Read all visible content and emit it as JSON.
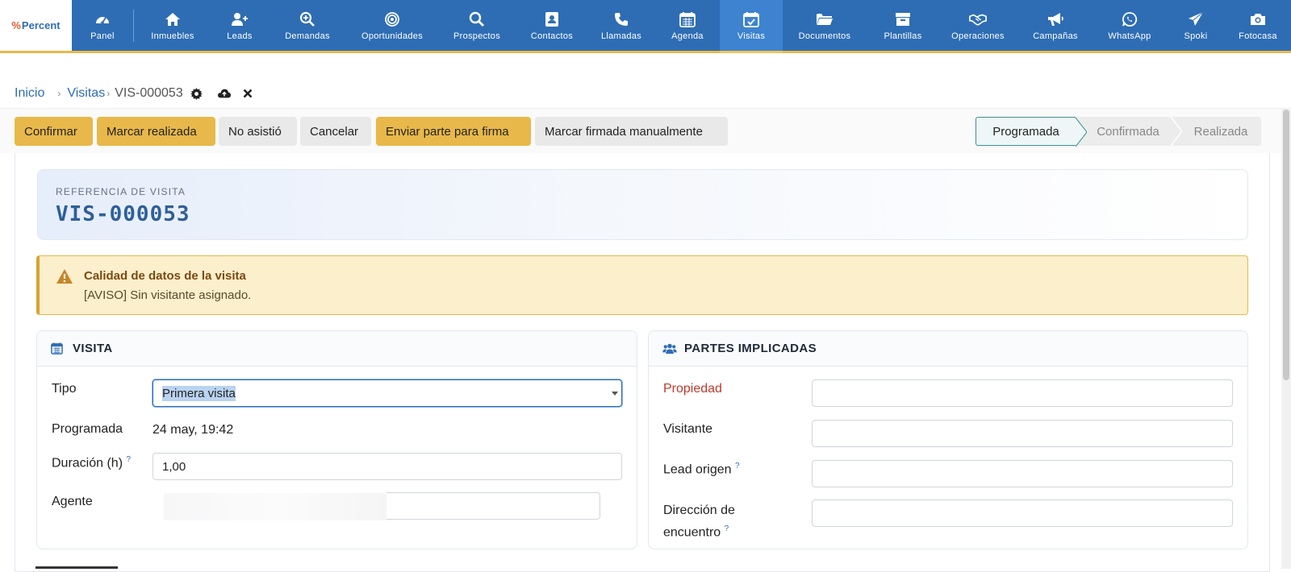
{
  "nav": {
    "logo_text": "Percent",
    "items": [
      {
        "label": "Panel",
        "icon": "dashboard-icon"
      },
      {
        "label": "Inmuebles",
        "icon": "home-icon"
      },
      {
        "label": "Leads",
        "icon": "user-plus-icon"
      },
      {
        "label": "Demandas",
        "icon": "search-plus-icon"
      },
      {
        "label": "Oportunidades",
        "icon": "target-icon"
      },
      {
        "label": "Prospectos",
        "icon": "search-icon"
      },
      {
        "label": "Contactos",
        "icon": "address-book-icon"
      },
      {
        "label": "Llamadas",
        "icon": "phone-icon"
      },
      {
        "label": "Agenda",
        "icon": "calendar-icon"
      },
      {
        "label": "Visitas",
        "icon": "calendar-check-icon",
        "active": true
      },
      {
        "label": "Documentos",
        "icon": "folder-open-icon"
      },
      {
        "label": "Plantillas",
        "icon": "archive-icon"
      },
      {
        "label": "Operaciones",
        "icon": "handshake-icon"
      },
      {
        "label": "Campañas",
        "icon": "megaphone-icon"
      },
      {
        "label": "WhatsApp",
        "icon": "whatsapp-icon"
      },
      {
        "label": "Spoki",
        "icon": "paper-plane-icon"
      },
      {
        "label": "Fotocasa",
        "icon": "camera-icon"
      }
    ]
  },
  "breadcrumb": {
    "home": "Inicio",
    "section": "Visitas",
    "current": "VIS-000053"
  },
  "actions": {
    "confirm": "Confirmar",
    "mark_done": "Marcar realizada",
    "no_show": "No asistió",
    "cancel": "Cancelar",
    "send_sign": "Enviar parte para firma",
    "mark_signed": "Marcar firmada manualmente"
  },
  "status": {
    "stages": [
      "Programada",
      "Confirmada",
      "Realizada"
    ],
    "current": "Programada"
  },
  "reference": {
    "label": "REFERENCIA DE VISITA",
    "value": "VIS-000053"
  },
  "alert": {
    "title": "Calidad de datos de la visita",
    "message": "[AVISO] Sin visitante asignado."
  },
  "visit": {
    "title": "VISITA",
    "tipo_label": "Tipo",
    "tipo_value": "Primera visita",
    "programada_label": "Programada",
    "programada_value": "24 may, 19:42",
    "duracion_label": "Duración (h)",
    "duracion_value": "1,00",
    "agente_label": "Agente"
  },
  "parties": {
    "title": "PARTES IMPLICADAS",
    "propiedad_label": "Propiedad",
    "visitante_label": "Visitante",
    "lead_label": "Lead origen",
    "direccion_label_1": "Dirección de",
    "direccion_label_2": "encuentro"
  },
  "help_mark": "?",
  "colors": {
    "nav_bg": "#2e6db4",
    "accent": "#e8b84a",
    "alert_bg": "#fcefcc",
    "required_label": "#c0392b"
  }
}
